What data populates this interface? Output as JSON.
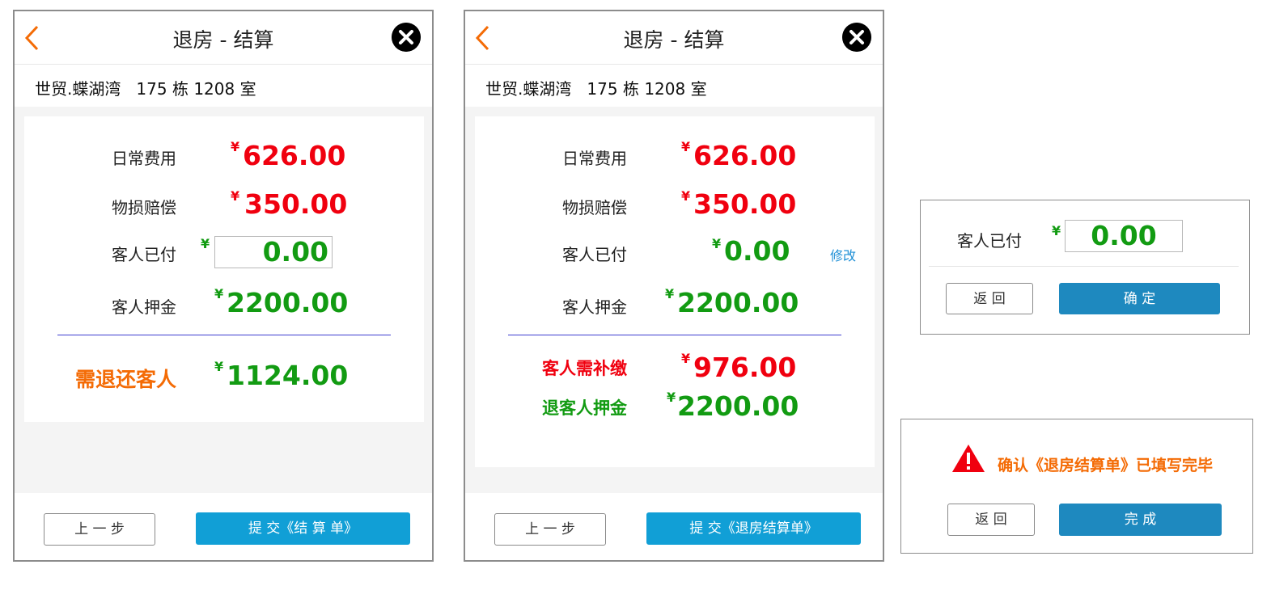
{
  "currency_symbol": "¥",
  "colors": {
    "red": "#f0000f",
    "green": "#129b12",
    "orange": "#f46b05",
    "blue_button": "#119fd6",
    "dark_blue_button": "#1e89bf",
    "divider": "#3d3dd0"
  },
  "screen1": {
    "title": "退房 - 结算",
    "address": "世贸.蝶湖湾   175 栋 1208 室",
    "daily_fee": {
      "label": "日常费用",
      "value": "626.00"
    },
    "damage": {
      "label": "物损赔偿",
      "value": "350.00"
    },
    "paid": {
      "label": "客人已付",
      "value": "0.00"
    },
    "deposit": {
      "label": "客人押金",
      "value": "2200.00"
    },
    "refund": {
      "label": "需退还客人",
      "value": "1124.00"
    },
    "prev_button": "上 一 步",
    "submit_button": "提 交《结 算 单》"
  },
  "screen2": {
    "title": "退房 - 结算",
    "address": "世贸.蝶湖湾   175 栋 1208 室",
    "daily_fee": {
      "label": "日常费用",
      "value": "626.00"
    },
    "damage": {
      "label": "物损赔偿",
      "value": "350.00"
    },
    "paid": {
      "label": "客人已付",
      "value": "0.00"
    },
    "edit_link": "修改",
    "deposit": {
      "label": "客人押金",
      "value": "2200.00"
    },
    "supplement": {
      "label": "客人需补缴",
      "value": "976.00"
    },
    "deposit_refund": {
      "label": "退客人押金",
      "value": "2200.00"
    },
    "prev_button": "上 一 步",
    "submit_button": "提 交《退房结算单》"
  },
  "dialog_paid": {
    "label": "客人已付",
    "value": "0.00",
    "back_button": "返 回",
    "confirm_button": "确 定"
  },
  "dialog_confirm": {
    "message": "确认《退房结算单》已填写完毕",
    "back_button": "返 回",
    "done_button": "完 成"
  }
}
